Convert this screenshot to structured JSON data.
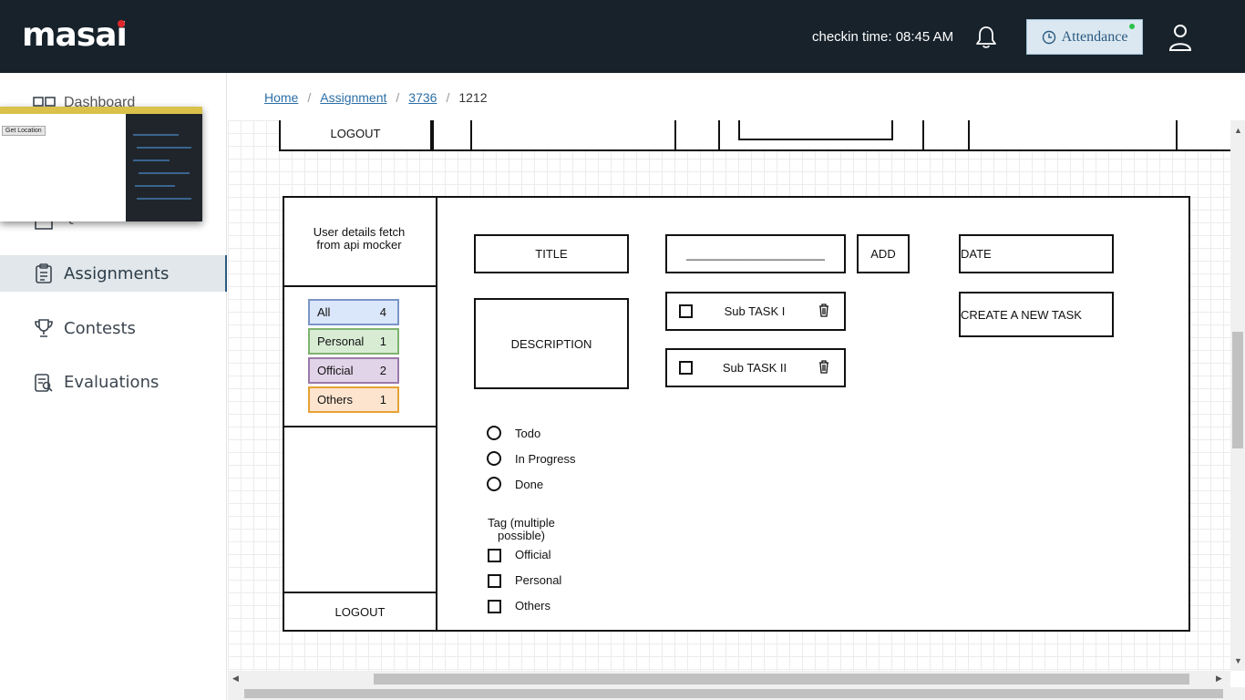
{
  "header": {
    "logo": "masai",
    "checkin": "checkin time: 08:45 AM",
    "attendance_label": "Attendance"
  },
  "sidebar": {
    "items": [
      {
        "label": "Dashboard",
        "icon": "dashboard-icon"
      },
      {
        "label": "Quiz",
        "icon": "quiz-icon"
      },
      {
        "label": "Assignments",
        "icon": "clipboard-icon",
        "active": true
      },
      {
        "label": "Contests",
        "icon": "trophy-icon"
      },
      {
        "label": "Evaluations",
        "icon": "evaluation-icon"
      }
    ],
    "popup_button": "Get Location"
  },
  "breadcrumb": {
    "home": "Home",
    "assignment": "Assignment",
    "id1": "3736",
    "current": "1212"
  },
  "wireframe": {
    "top_logout": "LOGOUT",
    "user_details": "User details fetch from api mocker",
    "tags": [
      {
        "label": "All",
        "count": "4",
        "bg": "#dae6fa",
        "border": "#7a95c7"
      },
      {
        "label": "Personal",
        "count": "1",
        "bg": "#d8ecd4",
        "border": "#7fb36f"
      },
      {
        "label": "Official",
        "count": "2",
        "bg": "#e2d4e8",
        "border": "#9b7aab"
      },
      {
        "label": "Others",
        "count": "1",
        "bg": "#fde4cf",
        "border": "#e6a233"
      }
    ],
    "logout": "LOGOUT",
    "title": "TITLE",
    "input_line": "_____________________",
    "add": "ADD",
    "date": "DATE",
    "description": "DESCRIPTION",
    "subtasks": [
      "Sub TASK I",
      "Sub TASK II"
    ],
    "create": "CREATE A NEW TASK",
    "status_options": [
      "Todo",
      "In Progress",
      "Done"
    ],
    "tag_heading": "Tag (multiple possible)",
    "tag_options": [
      "Official",
      "Personal",
      "Others"
    ]
  }
}
